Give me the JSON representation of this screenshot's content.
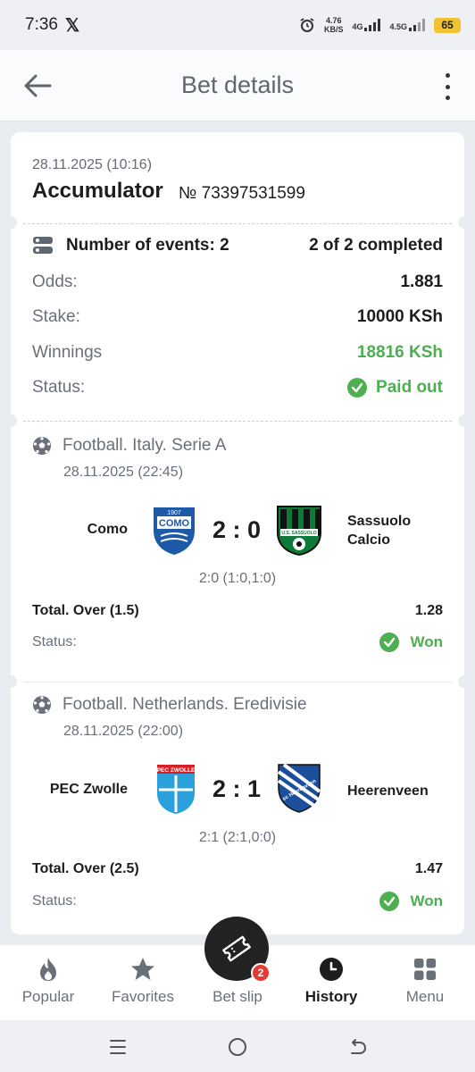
{
  "status_bar": {
    "time": "7:36",
    "x_logo": "𝕏",
    "net_speed": "4.76",
    "net_unit": "KB/S",
    "net1": "4G",
    "net2": "4.5G",
    "battery": "65"
  },
  "header": {
    "title": "Bet details"
  },
  "bet": {
    "date": "28.11.2025 (10:16)",
    "type": "Accumulator",
    "number": "№ 73397531599",
    "events_label": "Number of events: 2",
    "completed": "2 of 2 completed",
    "odds_label": "Odds:",
    "odds_value": "1.881",
    "stake_label": "Stake:",
    "stake_value": "10000 KSh",
    "winnings_label": "Winnings",
    "winnings_value": "18816 KSh",
    "status_label": "Status:",
    "status_value": "Paid out"
  },
  "events": [
    {
      "league": "Football. Italy. Serie A",
      "date": "28.11.2025 (22:45)",
      "home": "Como",
      "away_line1": "Sassuolo",
      "away_line2": "Calcio",
      "home_logo_text": "COMO",
      "home_logo_year": "1907",
      "away_logo_text": "U.S. SASSUOLO",
      "score": "2 : 0",
      "periods": "2:0 (1:0,1:0)",
      "bet_name": "Total. Over (1.5)",
      "bet_odds": "1.28",
      "status_label": "Status:",
      "status_value": "Won"
    },
    {
      "league": "Football. Netherlands. Eredivisie",
      "date": "28.11.2025 (22:00)",
      "home": "PEC Zwolle",
      "away_line1": "Heerenveen",
      "away_line2": "",
      "home_logo_text": "PEC ZWOLLE",
      "away_logo_text": "sc Heerenveen",
      "score": "2 : 1",
      "periods": "2:1 (2:1,0:0)",
      "bet_name": "Total. Over (2.5)",
      "bet_odds": "1.47",
      "status_label": "Status:",
      "status_value": "Won"
    }
  ],
  "bottom_nav": {
    "items": [
      {
        "label": "Popular",
        "icon": "flame-icon"
      },
      {
        "label": "Favorites",
        "icon": "star-icon"
      },
      {
        "label": "Bet slip",
        "icon": "ticket-icon"
      },
      {
        "label": "History",
        "icon": "clock-icon"
      },
      {
        "label": "Menu",
        "icon": "grid-icon"
      }
    ],
    "bet_slip_badge": "2",
    "active": "History"
  },
  "colors": {
    "accent_green": "#4caf50",
    "badge_red": "#e53935",
    "background": "#e9ecf1"
  }
}
